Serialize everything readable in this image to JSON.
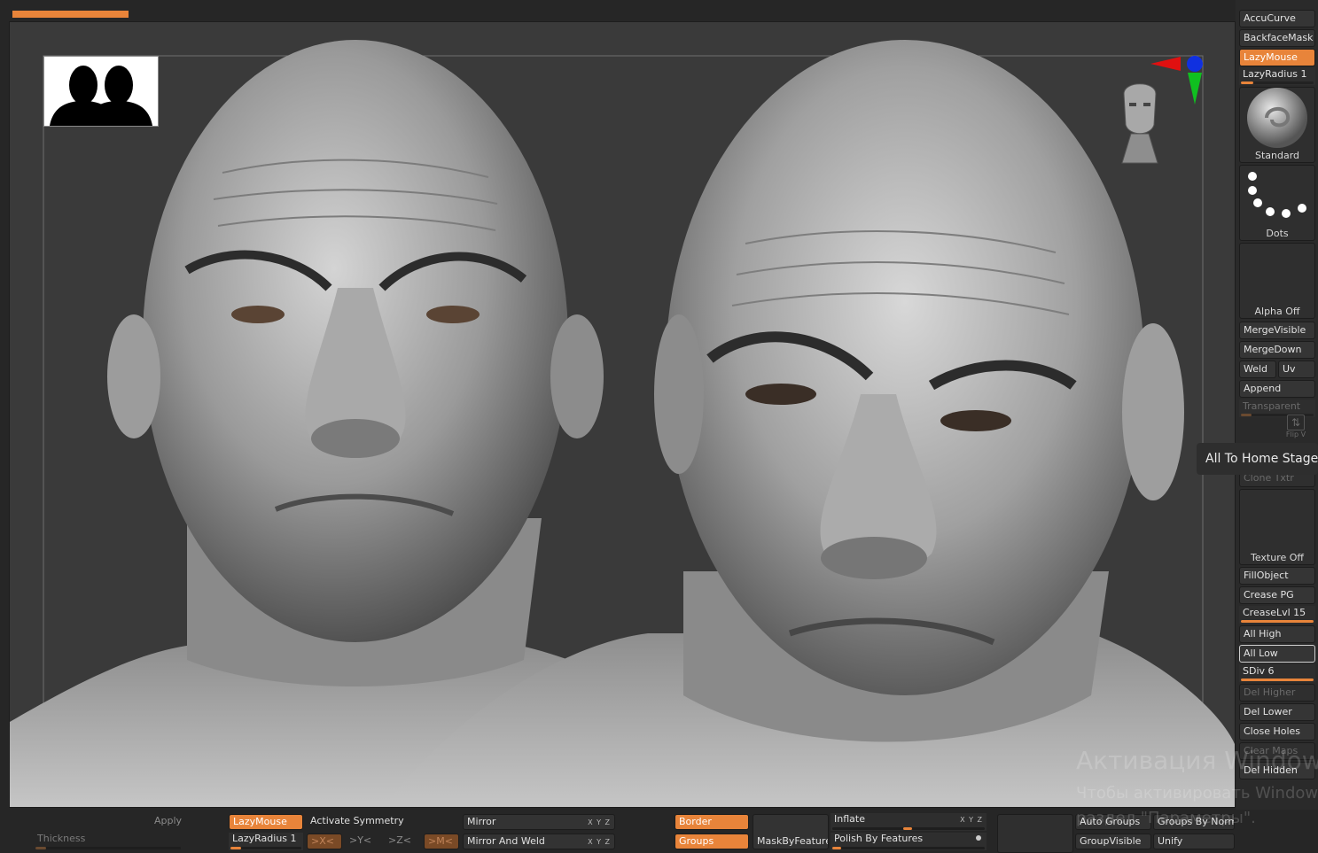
{
  "colors": {
    "accent": "#e8843a",
    "panel": "#2a2a2a",
    "viewport": "#3a3a3a"
  },
  "right_tray": {
    "accucurve": "AccuCurve",
    "backfacemask": "BackfaceMask",
    "lazymouse": "LazyMouse",
    "lazyradius": "LazyRadius 1",
    "brush_label": "Standard",
    "stroke_label": "Dots",
    "alpha_label": "Alpha Off",
    "mergevisible": "MergeVisible",
    "mergedown": "MergeDown",
    "weld": "Weld",
    "uv": "Uv",
    "append": "Append",
    "transparent": "Transparent",
    "flipv": "Flip V",
    "clonetxtr": "Clone Txtr",
    "texture_label": "Texture Off",
    "fillobject": "FillObject",
    "creasepg": "Crease PG",
    "creaselvl": "CreaseLvl 15",
    "allhigh": "All High",
    "alllow": "All Low",
    "sdiv": "SDiv 6",
    "delhigher": "Del Higher",
    "dellower": "Del Lower",
    "closeholes": "Close Holes",
    "clearmaps": "Clear Maps",
    "delhidden": "Del Hidden"
  },
  "tooltip": "All To Home Stage",
  "bottom_bar": {
    "thickness": "Thickness",
    "apply": "Apply",
    "lazymouse": "LazyMouse",
    "lazyradius": "LazyRadius 1",
    "activate_symmetry": "Activate Symmetry",
    "x_btn": ">X<",
    "y_btn": ">Y<",
    "z_btn": ">Z<",
    "m_btn": ">M<",
    "mirror": "Mirror",
    "mirror_weld": "Mirror And Weld",
    "xyz": "X Y Z",
    "border": "Border",
    "groups": "Groups",
    "maskbyfeature": "MaskByFeature",
    "inflate": "Inflate",
    "polish": "Polish By Features",
    "autogroups": "Auto Groups",
    "groupsbynorm": "Groups By Norm",
    "groupvisible": "GroupVisible",
    "unify": "Unify"
  },
  "watermark": {
    "line1": "Активация Windows",
    "line2": "Чтобы активировать Windows,",
    "line3": "раздел \"Параметры\"."
  }
}
